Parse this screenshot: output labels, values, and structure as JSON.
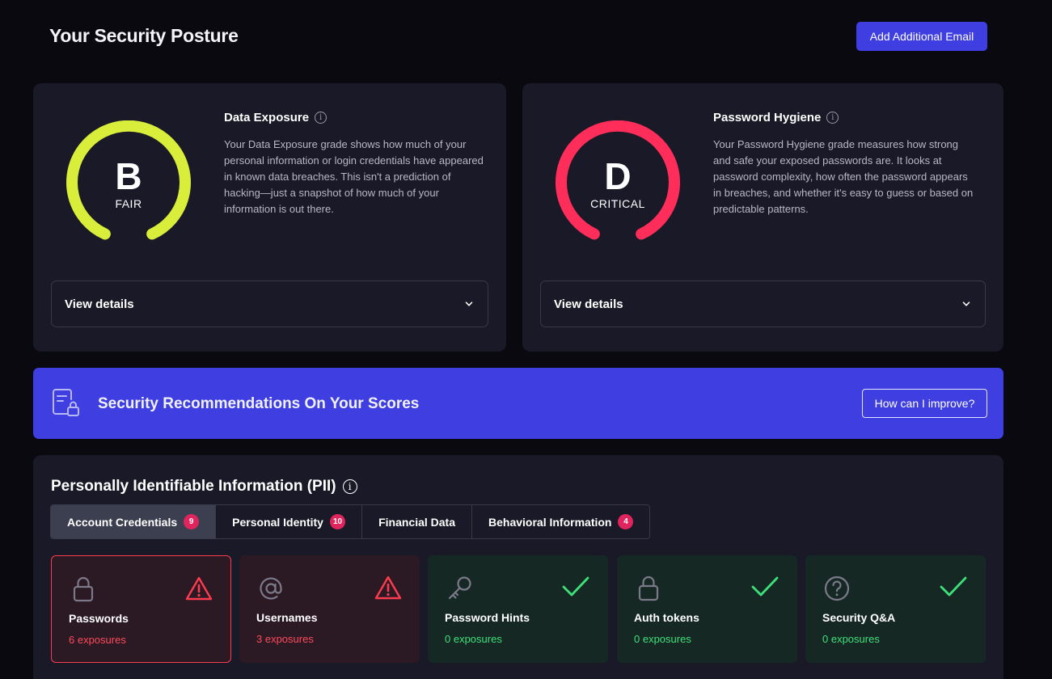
{
  "header": {
    "title": "Your Security Posture",
    "add_email_label": "Add Additional Email"
  },
  "colors": {
    "accent": "#3f3ee0",
    "grade_fair": "#d8ee3a",
    "grade_critical": "#ff2d5a",
    "danger": "#ff4a5e",
    "success": "#3ee07a"
  },
  "data_exposure": {
    "grade": "B",
    "grade_label": "FAIR",
    "title": "Data Exposure",
    "info_icon": "info-icon",
    "description": "Your Data Exposure grade shows how much of your personal information or login credentials have appeared in known data breaches. This isn't a prediction of hacking—just a snapshot of how much of your information is out there.",
    "details_label": "View details"
  },
  "password_hygiene": {
    "grade": "D",
    "grade_label": "CRITICAL",
    "title": "Password Hygiene",
    "info_icon": "info-icon",
    "description": "Your Password Hygiene grade measures how strong and safe your exposed passwords are. It looks at password complexity, how often the password appears in breaches, and whether it's easy to guess or based on predictable patterns.",
    "details_label": "View details"
  },
  "recommendations": {
    "title": "Security Recommendations On Your Scores",
    "button_label": "How can I improve?",
    "icon": "document-lock-icon"
  },
  "pii": {
    "title": "Personally Identifiable Information (PII)",
    "tabs": [
      {
        "label": "Account Credentials",
        "badge": "9",
        "active": true
      },
      {
        "label": "Personal Identity",
        "badge": "10",
        "active": false
      },
      {
        "label": "Financial Data",
        "badge": "",
        "active": false
      },
      {
        "label": "Behavioral Information",
        "badge": "4",
        "active": false
      }
    ],
    "tiles": [
      {
        "name": "Passwords",
        "count": "6 exposures",
        "icon": "lock-icon",
        "status": "warning-icon"
      },
      {
        "name": "Usernames",
        "count": "3 exposures",
        "icon": "at-sign-icon",
        "status": "warning-icon"
      },
      {
        "name": "Password Hints",
        "count": "0 exposures",
        "icon": "key-icon",
        "status": "check-icon"
      },
      {
        "name": "Auth tokens",
        "count": "0 exposures",
        "icon": "lock-icon",
        "status": "check-icon"
      },
      {
        "name": "Security Q&A",
        "count": "0 exposures",
        "icon": "question-circle-icon",
        "status": "check-icon"
      }
    ]
  }
}
